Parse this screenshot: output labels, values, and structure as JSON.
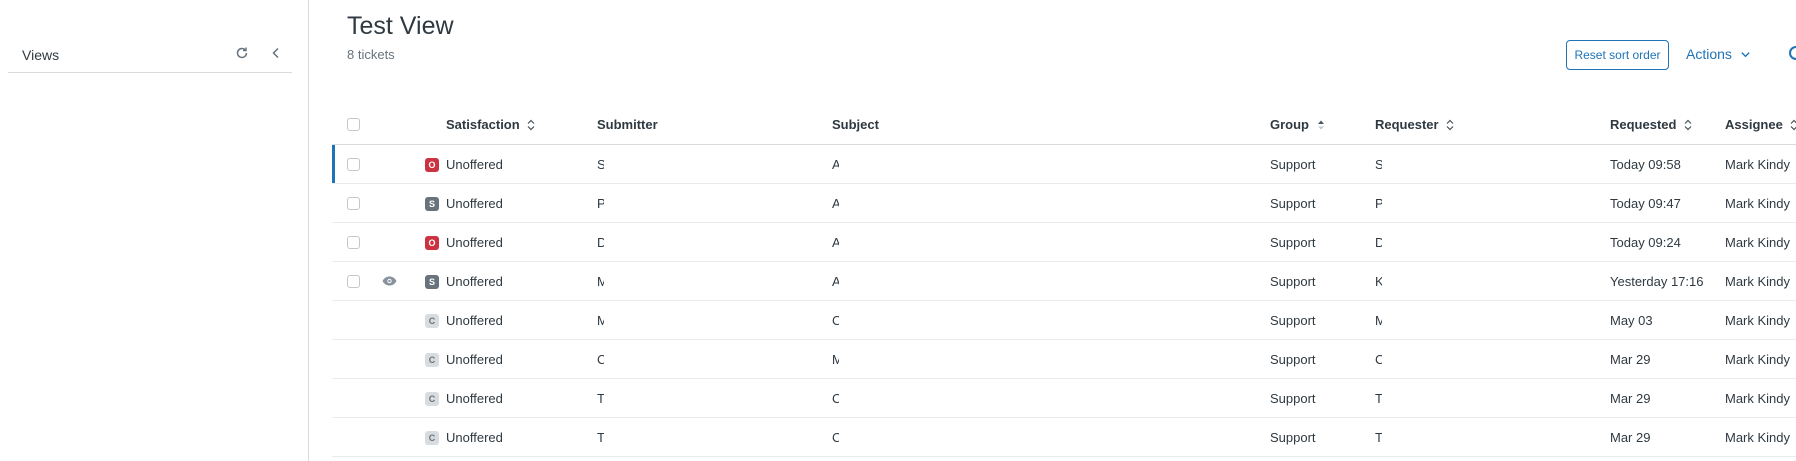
{
  "sidebar": {
    "title": "Views"
  },
  "view": {
    "title": "Test View",
    "count": "8 tickets",
    "reset_label": "Reset sort order",
    "actions_label": "Actions"
  },
  "columns": {
    "satisfaction": "Satisfaction",
    "submitter": "Submitter",
    "subject": "Subject",
    "group": "Group",
    "requester": "Requester",
    "requested": "Requested",
    "assignee": "Assignee"
  },
  "rows": [
    {
      "status": "O",
      "satisfaction": "Unoffered",
      "submitter": "S",
      "subject": "A",
      "group": "Support",
      "requester": "S",
      "requested": "Today 09:58",
      "assignee": "Mark Kindy"
    },
    {
      "status": "S",
      "satisfaction": "Unoffered",
      "submitter": "P",
      "subject": "A",
      "group": "Support",
      "requester": "P",
      "requested": "Today 09:47",
      "assignee": "Mark Kindy"
    },
    {
      "status": "O",
      "satisfaction": "Unoffered",
      "submitter": "D",
      "subject": "A",
      "group": "Support",
      "requester": "D",
      "requested": "Today 09:24",
      "assignee": "Mark Kindy"
    },
    {
      "status": "S",
      "satisfaction": "Unoffered",
      "submitter": "M",
      "subject": "A",
      "group": "Support",
      "requester": "K",
      "requested": "Yesterday 17:16",
      "assignee": "Mark Kindy"
    },
    {
      "status": "C",
      "satisfaction": "Unoffered",
      "submitter": "M",
      "subject": "C",
      "group": "Support",
      "requester": "M",
      "requested": "May 03",
      "assignee": "Mark Kindy"
    },
    {
      "status": "C",
      "satisfaction": "Unoffered",
      "submitter": "C",
      "subject": "M",
      "group": "Support",
      "requester": "C",
      "requested": "Mar 29",
      "assignee": "Mark Kindy"
    },
    {
      "status": "C",
      "satisfaction": "Unoffered",
      "submitter": "T",
      "subject": "C",
      "group": "Support",
      "requester": "T",
      "requested": "Mar 29",
      "assignee": "Mark Kindy"
    },
    {
      "status": "C",
      "satisfaction": "Unoffered",
      "submitter": "T",
      "subject": "C",
      "group": "Support",
      "requester": "T",
      "requested": "Mar 29",
      "assignee": "Mark Kindy"
    }
  ]
}
